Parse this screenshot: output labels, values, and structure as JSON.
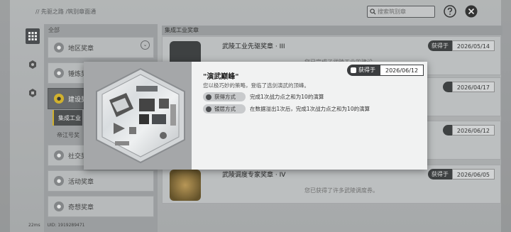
{
  "breadcrumb": "// 先驱之路 /筑别章面通",
  "search": {
    "placeholder": "搜索筑别章"
  },
  "categories": {
    "header": "全部",
    "items": [
      {
        "label": "地区奖章"
      },
      {
        "label": "锤炼奖章"
      },
      {
        "label": "建设奖章"
      },
      {
        "label": "社交奖章"
      },
      {
        "label": "活动奖章"
      },
      {
        "label": "奇想奖章"
      }
    ],
    "subs": [
      {
        "label": "集成工业"
      },
      {
        "label": "帝江号奖"
      }
    ]
  },
  "list": {
    "header": "集成工业奖章",
    "rows": [
      {
        "title": "武陵工业先驱奖章 · III",
        "tag": "获得于",
        "date": "2026/05/14",
        "desc": "您已完成了武陵工业的建设……"
      },
      {
        "title": "",
        "tag": "",
        "date": "2026/04/17",
        "desc": ""
      },
      {
        "title": "",
        "tag": "",
        "date": "2026/06/12",
        "desc": ""
      },
      {
        "title": "武陵调度专家奖章 · IV",
        "tag": "获得于",
        "date": "2026/06/05",
        "desc": "您已获得了许多武陵调度券。"
      }
    ]
  },
  "modal": {
    "title": "\"演武巅峰\"",
    "desc": "您以极巧妙的策略，登临了选剑演武的顶峰。",
    "tag": "获得于",
    "date": "2026/06/12",
    "obtain_label": "获得方式",
    "obtain_text": "完成1次战力点之和为10的演算",
    "plate_label": "镀层方式",
    "plate_text": "在数据溢出1次后，完成1次战力点之和为10的演算"
  },
  "status": {
    "ping": "22ms",
    "uid": "UID: 1919289471"
  },
  "colors": {
    "accent": "#e5c12c",
    "dark": "#3b3d3f"
  }
}
